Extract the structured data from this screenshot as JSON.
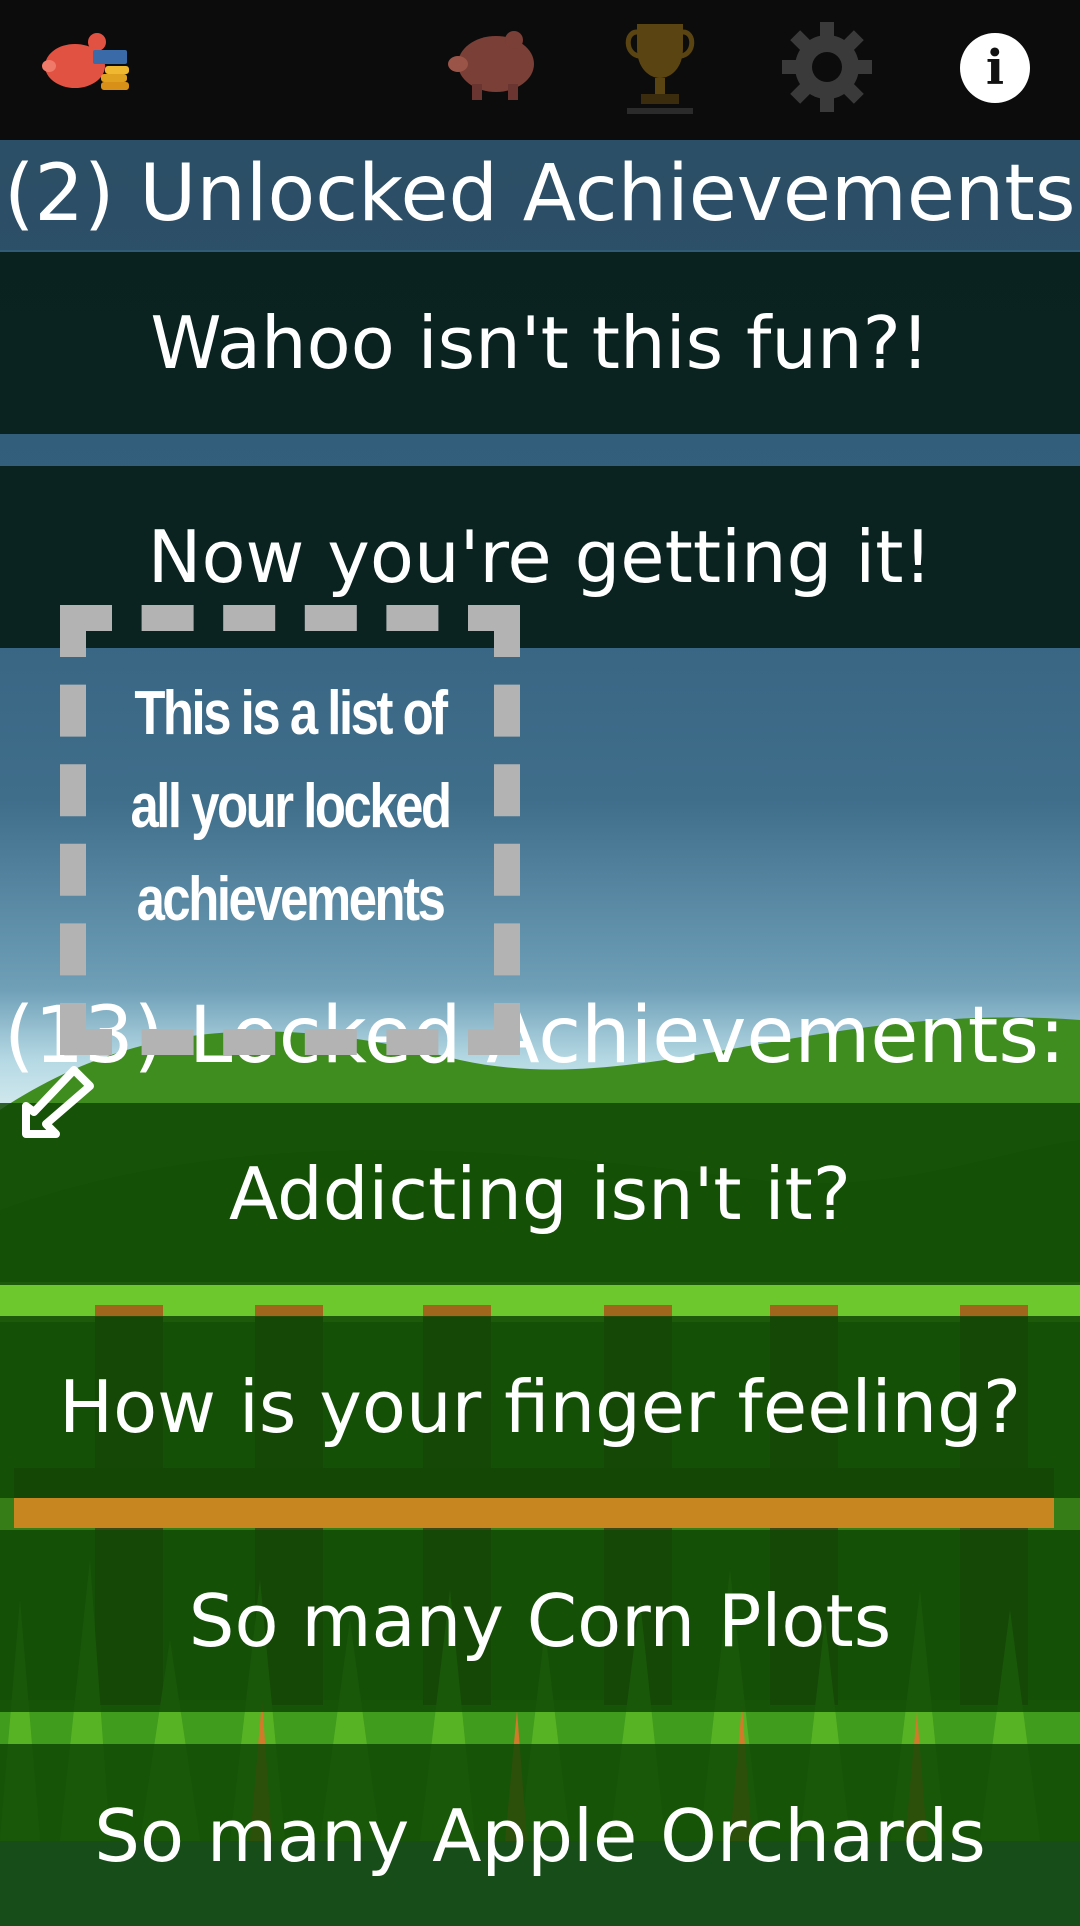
{
  "topbar": {
    "icons": [
      "piggy-bank-coins-icon",
      "piggy-bank-icon",
      "trophy-icon",
      "gear-icon",
      "info-icon"
    ],
    "info_glyph": "i"
  },
  "unlocked": {
    "header": "(2) Unlocked Achievements:",
    "items": [
      "Wahoo isn't this fun?!",
      "Now you're getting it!"
    ]
  },
  "locked": {
    "header": "(13) Locked Achievements:",
    "items": [
      "Addicting isn't it?",
      "How is your finger feeling?",
      "So many Corn Plots",
      "So many Apple Orchards"
    ]
  },
  "tooltip": {
    "text": "This is a list of all your locked achievements"
  },
  "colors": {
    "topbar": "#0c0c0c",
    "row_dark": "#051c16",
    "row_green": "#0f4805",
    "grass": "#5cb82a",
    "fence": "#c7861f"
  }
}
